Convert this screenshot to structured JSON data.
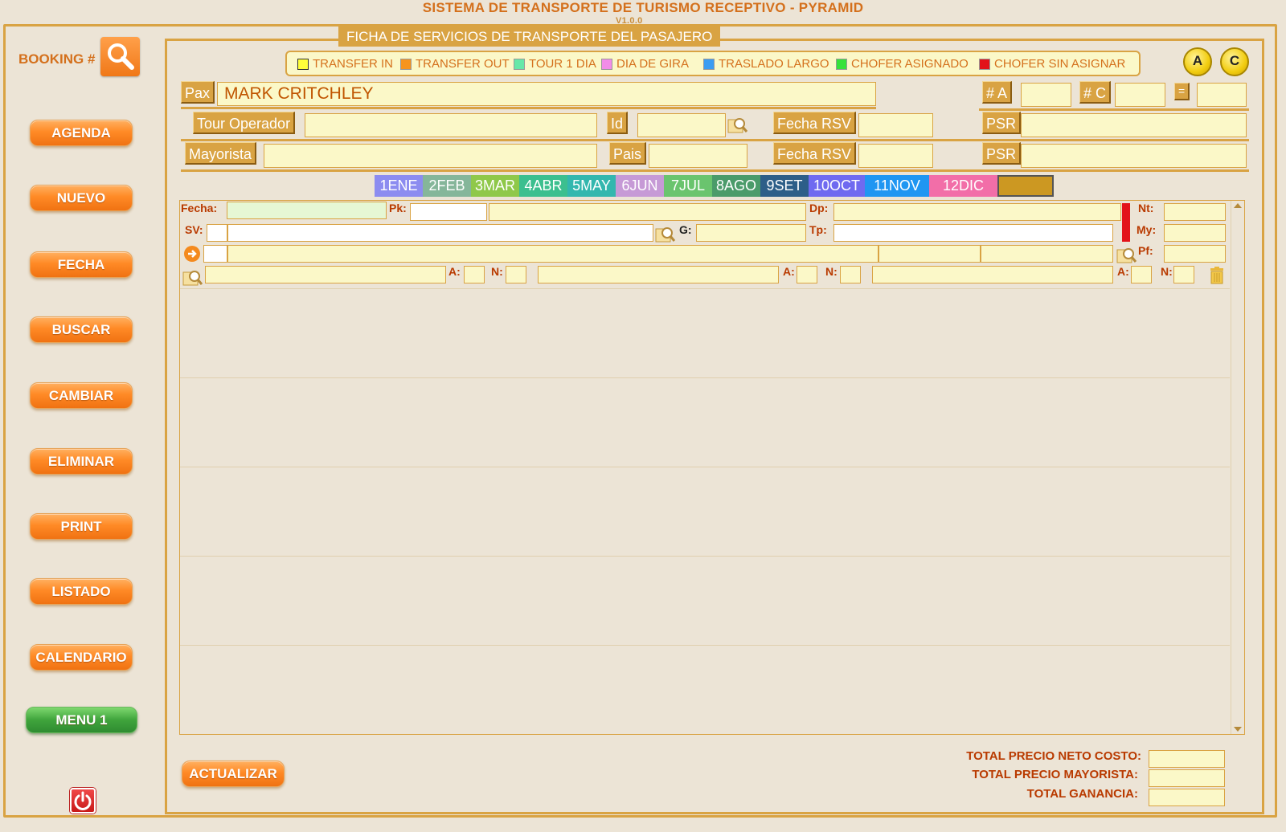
{
  "app": {
    "title": "SISTEMA DE TRANSPORTE DE TURISMO RECEPTIVO - PYRAMID",
    "version": "V1.0.0"
  },
  "sidebar": {
    "booking_label": "BOOKING #",
    "buttons": [
      "AGENDA",
      "NUEVO",
      "FECHA",
      "BUSCAR",
      "CAMBIAR",
      "ELIMINAR",
      "PRINT",
      "LISTADO",
      "CALENDARIO"
    ],
    "menu_button": "MENU 1"
  },
  "section_title": "FICHA DE SERVICIOS DE TRANSPORTE DEL PASAJERO",
  "legend": [
    {
      "label": "TRANSFER IN",
      "color": "#ffff3a"
    },
    {
      "label": "TRANSFER OUT",
      "color": "#f7941d"
    },
    {
      "label": "TOUR 1 DIA",
      "color": "#66e8a8"
    },
    {
      "label": "DIA DE GIRA",
      "color": "#f28ce8"
    },
    {
      "label": "TRASLADO LARGO",
      "color": "#3b9cf2"
    },
    {
      "label": "CHOFER ASIGNADO",
      "color": "#36e23a"
    },
    {
      "label": "CHOFER SIN ASIGNAR",
      "color": "#e3131a"
    }
  ],
  "circle_buttons": {
    "a": "A",
    "c": "C"
  },
  "form": {
    "pax_label": "Pax",
    "pax_value": "MARK CRITCHLEY",
    "num_a_label": "# A",
    "num_c_label": "# C",
    "equals_label": "=",
    "tour_operador_label": "Tour Operador",
    "id_label": "Id",
    "fecha_rsv_label_1": "Fecha RSV",
    "psr_label_1": "PSR",
    "mayorista_label": "Mayorista",
    "pais_label": "Pais",
    "fecha_rsv_label_2": "Fecha RSV",
    "psr_label_2": "PSR"
  },
  "months": [
    {
      "label": "1ENE",
      "color": "#8c8cf0"
    },
    {
      "label": "2FEB",
      "color": "#85b69a"
    },
    {
      "label": "3MAR",
      "color": "#8fc84a"
    },
    {
      "label": "4ABR",
      "color": "#3cbf8f"
    },
    {
      "label": "5MAY",
      "color": "#33b7ae"
    },
    {
      "label": "6JUN",
      "color": "#c69ad6"
    },
    {
      "label": "7JUL",
      "color": "#6ac46e"
    },
    {
      "label": "8AGO",
      "color": "#4b9b6a"
    },
    {
      "label": "9SET",
      "color": "#2d5e88"
    },
    {
      "label": "10OCT",
      "color": "#6f6af0"
    },
    {
      "label": "11NOV",
      "color": "#1f96f2"
    },
    {
      "label": "12DIC",
      "color": "#f26ea8"
    }
  ],
  "detail": {
    "fecha_label": "Fecha:",
    "pk_label": "Pk:",
    "dp_label": "Dp:",
    "nt_label": "Nt:",
    "sv_label": "SV:",
    "g_label": "G:",
    "tp_label": "Tp:",
    "my_label": "My:",
    "pf_label": "Pf:",
    "a_label": "A:",
    "n_label": "N:"
  },
  "actions": {
    "actualizar": "ACTUALIZAR"
  },
  "totals": {
    "neto_label": "TOTAL PRECIO NETO COSTO:",
    "mayorista_label": "TOTAL PRECIO MAYORISTA:",
    "ganancia_label": "TOTAL GANANCIA:"
  }
}
